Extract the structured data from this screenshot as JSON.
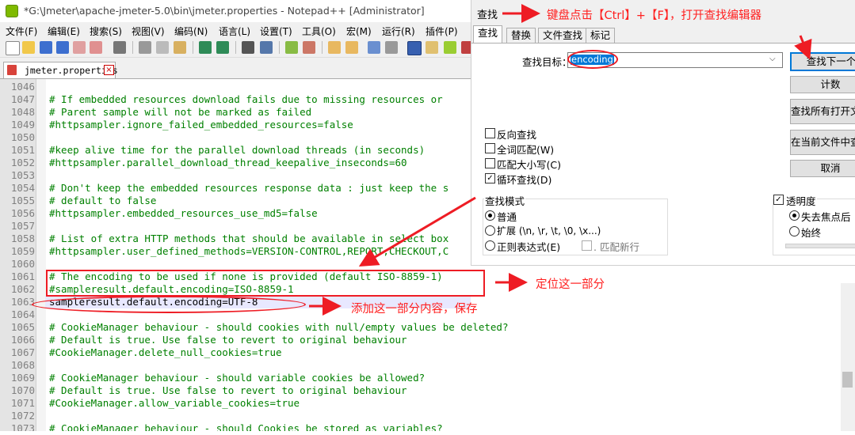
{
  "window": {
    "title": "*G:\\Jmeter\\apache-jmeter-5.0\\bin\\jmeter.properties - Notepad++ [Administrator]"
  },
  "menu": [
    "文件(F)",
    "编辑(E)",
    "搜索(S)",
    "视图(V)",
    "编码(N)",
    "语言(L)",
    "设置(T)",
    "工具(O)",
    "宏(M)",
    "运行(R)",
    "插件(P)"
  ],
  "tab": {
    "label": "jmeter.properties",
    "close": "×"
  },
  "editor": {
    "lines": [
      {
        "n": "1046",
        "t": "",
        "c": "kv"
      },
      {
        "n": "1047",
        "t": "# If embedded resources download fails due to missing resources or",
        "c": "cm"
      },
      {
        "n": "1048",
        "t": "# Parent sample will not be marked as failed",
        "c": "cm"
      },
      {
        "n": "1049",
        "t": "#httpsampler.ignore_failed_embedded_resources=false",
        "c": "cm"
      },
      {
        "n": "1050",
        "t": "",
        "c": "kv"
      },
      {
        "n": "1051",
        "t": "#keep alive time for the parallel download threads (in seconds)",
        "c": "cm"
      },
      {
        "n": "1052",
        "t": "#httpsampler.parallel_download_thread_keepalive_inseconds=60",
        "c": "cm"
      },
      {
        "n": "1053",
        "t": "",
        "c": "kv"
      },
      {
        "n": "1054",
        "t": "# Don't keep the embedded resources response data : just keep the s",
        "c": "cm"
      },
      {
        "n": "1055",
        "t": "# default to false",
        "c": "cm"
      },
      {
        "n": "1056",
        "t": "#httpsampler.embedded_resources_use_md5=false",
        "c": "cm"
      },
      {
        "n": "1057",
        "t": "",
        "c": "kv"
      },
      {
        "n": "1058",
        "t": "# List of extra HTTP methods that should be available in select box",
        "c": "cm"
      },
      {
        "n": "1059",
        "t": "#httpsampler.user_defined_methods=VERSION-CONTROL,REPORT,CHECKOUT,C",
        "c": "cm"
      },
      {
        "n": "1060",
        "t": "",
        "c": "kv"
      },
      {
        "n": "1061",
        "t": "# The encoding to be used if none is provided (default ISO-8859-1)",
        "c": "cm"
      },
      {
        "n": "1062",
        "t": "#sampleresult.default.encoding=ISO-8859-1",
        "c": "cm"
      },
      {
        "n": "1063",
        "t": "sampleresult.default.encoding=UTF-8",
        "c": "kv"
      },
      {
        "n": "1064",
        "t": "",
        "c": "kv"
      },
      {
        "n": "1065",
        "t": "# CookieManager behaviour - should cookies with null/empty values be deleted?",
        "c": "cm"
      },
      {
        "n": "1066",
        "t": "# Default is true. Use false to revert to original behaviour",
        "c": "cm"
      },
      {
        "n": "1067",
        "t": "#CookieManager.delete_null_cookies=true",
        "c": "cm"
      },
      {
        "n": "1068",
        "t": "",
        "c": "kv"
      },
      {
        "n": "1069",
        "t": "# CookieManager behaviour - should variable cookies be allowed?",
        "c": "cm"
      },
      {
        "n": "1070",
        "t": "# Default is true. Use false to revert to original behaviour",
        "c": "cm"
      },
      {
        "n": "1071",
        "t": "#CookieManager.allow_variable_cookies=true",
        "c": "cm"
      },
      {
        "n": "1072",
        "t": "",
        "c": "kv"
      },
      {
        "n": "1073",
        "t": "# CookieManager behaviour - should Cookies be stored as variables?",
        "c": "cm"
      }
    ]
  },
  "find_dialog": {
    "title": "查找",
    "tabs": [
      "查找",
      "替换",
      "文件查找",
      "标记"
    ],
    "find_label": "查找目标：",
    "find_value": "encoding",
    "buttons": {
      "find_next": "查找下一个",
      "count": "计数",
      "find_all_open": "查找所有打开文件",
      "find_all_current": "在当前文件中查找"
    },
    "cancel": "取消",
    "options": {
      "backward": "反向查找",
      "whole_word": "全词匹配(W)",
      "match_case": "匹配大小写(C)",
      "wrap": "循环查找(D)"
    },
    "mode": {
      "title": "查找模式",
      "normal": "普通",
      "extended": "扩展 (\\n, \\r, \\t, \\0, \\x...)",
      "regex": "正则表达式(E)",
      "dot_newline": ". 匹配新行"
    },
    "transparency": {
      "title": "透明度",
      "on_lose_focus": "失去焦点后",
      "always": "始终"
    }
  },
  "annotations": {
    "shortcut": "键盘点击【Ctrl】+【F】，打开查找编辑器",
    "locate": "定位这一部分",
    "add": "添加这一部分内容，保存"
  }
}
